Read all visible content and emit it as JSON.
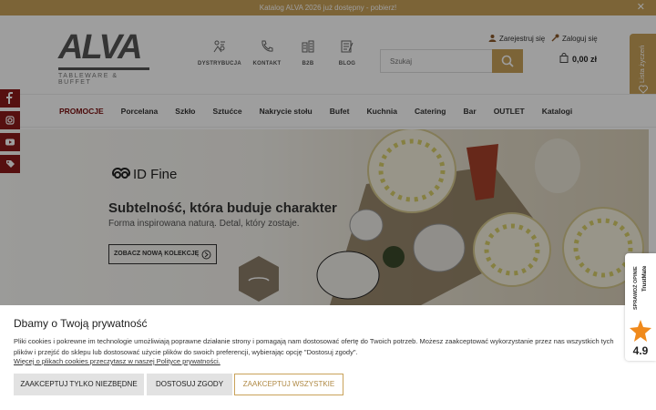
{
  "topbar": {
    "text": "Katalog ALVA 2026 już dostępny - pobierz!",
    "close": "✕"
  },
  "logo": {
    "name": "ALVA",
    "tagline": "TABLEWARE & BUFFET"
  },
  "header_links": [
    {
      "label": "DYSTRYBUCJA",
      "icon": "distribution-icon"
    },
    {
      "label": "KONTAKT",
      "icon": "phone-icon"
    },
    {
      "label": "B2B",
      "icon": "b2b-icon"
    },
    {
      "label": "BLOG",
      "icon": "blog-icon"
    }
  ],
  "search": {
    "placeholder": "Szukaj"
  },
  "account": {
    "register": "Zarejestruj się",
    "login": "Zaloguj się"
  },
  "cart": {
    "total": "0,00 zł"
  },
  "wishlist": {
    "label": "Lista życzeń"
  },
  "nav": [
    "PROMOCJE",
    "Porcelana",
    "Szkło",
    "Sztućce",
    "Nakrycie stołu",
    "Bufet",
    "Kuchnia",
    "Catering",
    "Bar",
    "OUTLET",
    "Katalogi"
  ],
  "social": [
    {
      "icon": "facebook-icon",
      "color": "#8b1a1a"
    },
    {
      "icon": "instagram-icon",
      "color": "#8b1a1a"
    },
    {
      "icon": "youtube-icon",
      "color": "#8b1a1a"
    },
    {
      "icon": "tag-icon",
      "color": "#8b1a1a"
    }
  ],
  "hero": {
    "brand": "ID Fine",
    "title": "Subtelność, która buduje charakter",
    "subtitle": "Forma inspirowana naturą. Detal, który zostaje.",
    "cta": "ZOBACZ NOWĄ KOLEKCJĘ"
  },
  "cookie": {
    "title": "Dbamy o Twoją prywatność",
    "description": "Pliki cookies i pokrewne im technologie umożliwiają poprawne działanie strony i pomagają nam dostosować ofertę do Twoich potrzeb. Możesz zaakceptować wykorzystanie przez nas wszystkich tych plików i przejść do sklepu lub dostosować użycie plików do swoich preferencji, wybierając opcję \"Dostosuj zgody\".",
    "more_link": "Więcej o plikach cookies przeczytasz w naszej Polityce prywatności.",
    "btn_necessary": "ZAAKCEPTUJ TYLKO NIEZBĘDNE",
    "btn_customize": "DOSTOSUJ ZGODY",
    "btn_accept_all": "ZAAKCEPTUJ WSZYSTKIE"
  },
  "trustmate": {
    "label": "SPRAWDŹ OPINIE",
    "brand": "TrustMate",
    "score": "4.9"
  },
  "colors": {
    "accent": "#c9a25a",
    "promo": "#7a1010",
    "social": "#8b1a1a"
  }
}
